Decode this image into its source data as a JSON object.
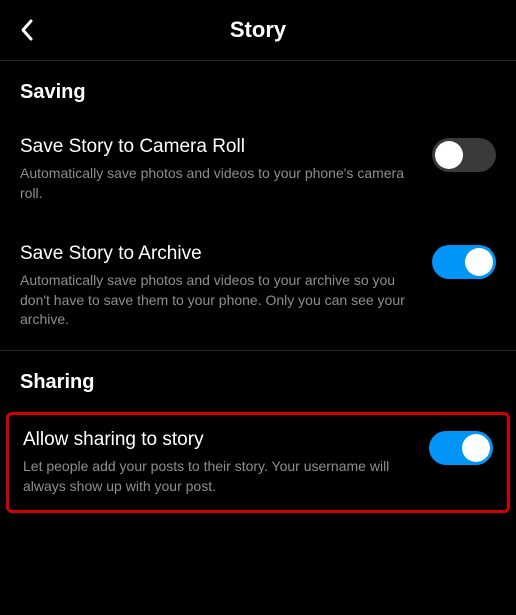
{
  "header": {
    "title": "Story"
  },
  "sections": {
    "saving": {
      "label": "Saving",
      "items": {
        "camera_roll": {
          "title": "Save Story to Camera Roll",
          "desc": "Automatically save photos and videos to your phone's camera roll.",
          "enabled": false
        },
        "archive": {
          "title": "Save Story to Archive",
          "desc": "Automatically save photos and videos to your archive so you don't have to save them to your phone. Only you can see your archive.",
          "enabled": true
        }
      }
    },
    "sharing": {
      "label": "Sharing",
      "items": {
        "allow_share": {
          "title": "Allow sharing to story",
          "desc": "Let people add your posts to their story. Your username will always show up with your post.",
          "enabled": true
        }
      }
    }
  }
}
